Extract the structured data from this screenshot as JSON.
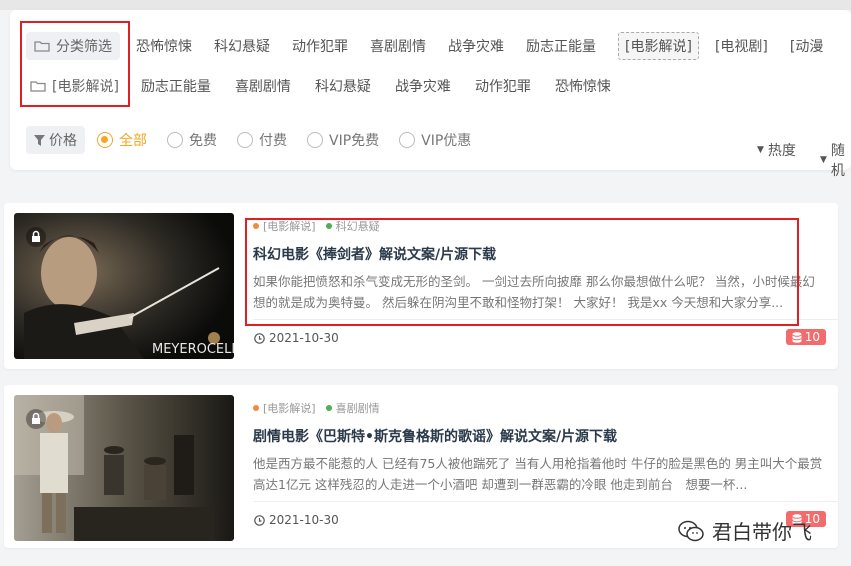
{
  "filter": {
    "category_label": "分类筛选",
    "row1": [
      "恐怖惊悚",
      "科幻悬疑",
      "动作犯罪",
      "喜剧剧情",
      "战争灾难",
      "励志正能量",
      "[电影解说]",
      "[电视剧]",
      "[动漫"
    ],
    "row1_active_index": 6,
    "subcategory_label": "[电影解说]",
    "row2": [
      "励志正能量",
      "喜剧剧情",
      "科幻悬疑",
      "战争灾难",
      "动作犯罪",
      "恐怖惊悚"
    ],
    "price_label": "价格",
    "price_options": [
      "全部",
      "免费",
      "付费",
      "VIP免费",
      "VIP优惠"
    ],
    "price_selected_index": 0,
    "sort_hot": "热度",
    "sort_random": "随机"
  },
  "posts": [
    {
      "tag1": "[电影解说]",
      "tag2": "科幻悬疑",
      "title": "科幻电影《捧剑者》解说文案/片源下载",
      "excerpt": "如果你能把愤怒和杀气变成无形的圣剑。 一剑过去所向披靡 那么你最想做什么呢？ 当然，小时候最幻想的就是成为奥特曼。 然后躲在阴沟里不敢和怪物打架！ 大家好！ 我是xx 今天想和大家分享...",
      "date": "2021-10-30",
      "count": "10",
      "thumb_text": "MEYEROCELL"
    },
    {
      "tag1": "[电影解说]",
      "tag2": "喜剧剧情",
      "title": "剧情电影《巴斯特•斯克鲁格斯的歌谣》解说文案/片源下载",
      "excerpt": "他是西方最不能惹的人 已经有75人被他踹死了 当有人用枪指着他时 牛仔的脸是黑色的 男主叫大个最赏高达1亿元 这样残忍的人走进一个小酒吧 却遭到一群恶霸的冷眼 他走到前台　想要一杯...",
      "date": "2021-10-30",
      "count": "10"
    }
  ],
  "watermark": "君白带你飞",
  "colors": {
    "accent": "#f5a623",
    "highlight_box": "#e02020",
    "badge": "#f36b6b",
    "tag_dot_orange": "#f08a3c",
    "tag_dot_green": "#4caf50"
  },
  "icons": [
    "folder-icon",
    "funnel-icon",
    "caret-down-icon",
    "lock-icon",
    "clock-icon",
    "database-icon",
    "wechat-icon"
  ]
}
